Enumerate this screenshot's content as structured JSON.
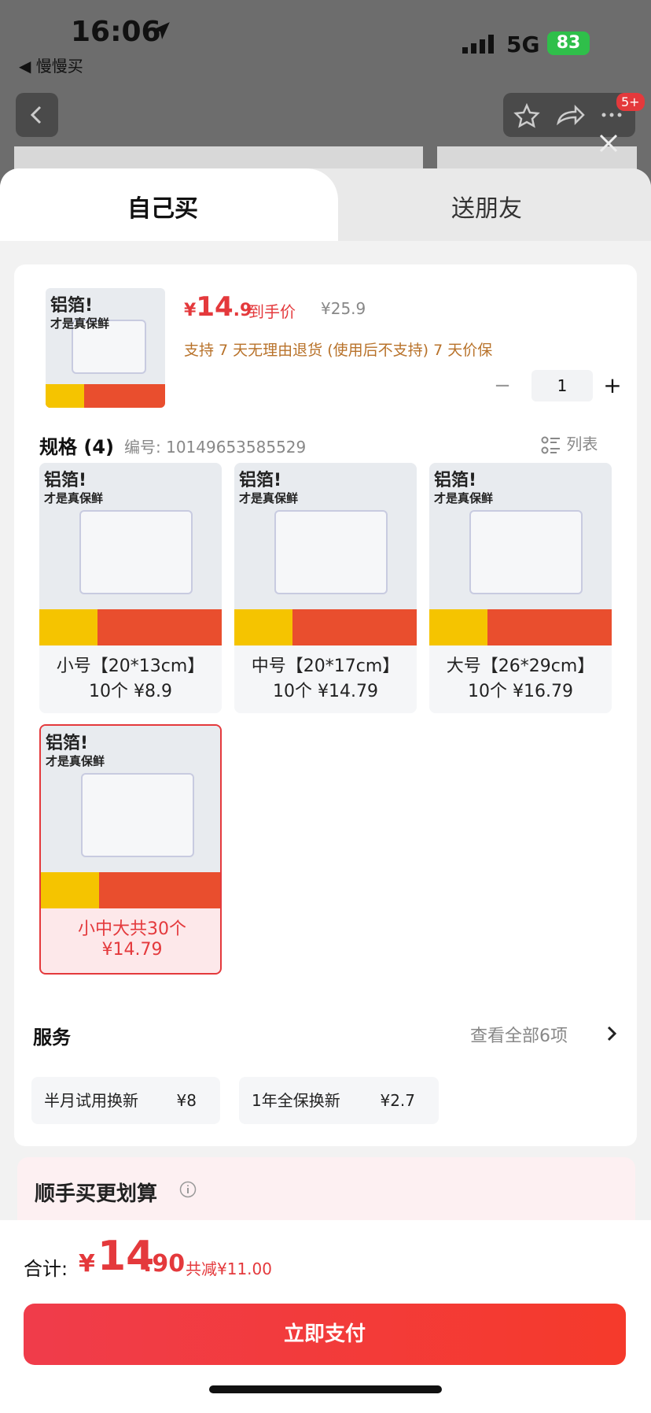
{
  "status": {
    "time": "16:06",
    "back_app": "◀ 慢慢买",
    "network": "5G",
    "battery": "83"
  },
  "badge": "5+",
  "tabs": [
    {
      "label": "自己买"
    },
    {
      "label": "送朋友"
    }
  ],
  "product": {
    "thumb_title": "铝箔!",
    "thumb_sub": "才是真保鲜",
    "price_yen": "¥",
    "price_int": "14",
    "price_dec": ".9",
    "price_tag": "到手价",
    "price_orig": "¥25.9",
    "policy": "支持 7 天无理由退货 (使用后不支持)   7 天价保"
  },
  "quantity": {
    "minus": "−",
    "value": "1",
    "plus": "+"
  },
  "spec": {
    "title": "规格 (4)",
    "code": "编号: 10149653585529",
    "list_label": "列表"
  },
  "options": [
    {
      "line1": "小号【20*13cm】",
      "line2": "10个 ¥8.9"
    },
    {
      "line1": "中号【20*17cm】",
      "line2": "10个 ¥14.79"
    },
    {
      "line1": "大号【26*29cm】",
      "line2": "10个 ¥16.79"
    },
    {
      "line1": "小中大共30个",
      "line2": "¥14.79"
    }
  ],
  "services": {
    "title": "服务",
    "view_all": "查看全部6项",
    "chips": [
      {
        "name": "半月试用换新",
        "price": "¥8"
      },
      {
        "name": "1年全保换新",
        "price": "¥2.7"
      }
    ]
  },
  "addon": {
    "title": "顺手买更划算"
  },
  "footer": {
    "total_label": "合计:",
    "yen": "¥",
    "total_int": "14",
    "total_dec": ".90",
    "saved": "共减¥11.00",
    "pay_label": "立即支付"
  },
  "colors": {
    "accent": "#e4393c",
    "policy": "#b8722a",
    "battery": "#2fbf4a"
  }
}
